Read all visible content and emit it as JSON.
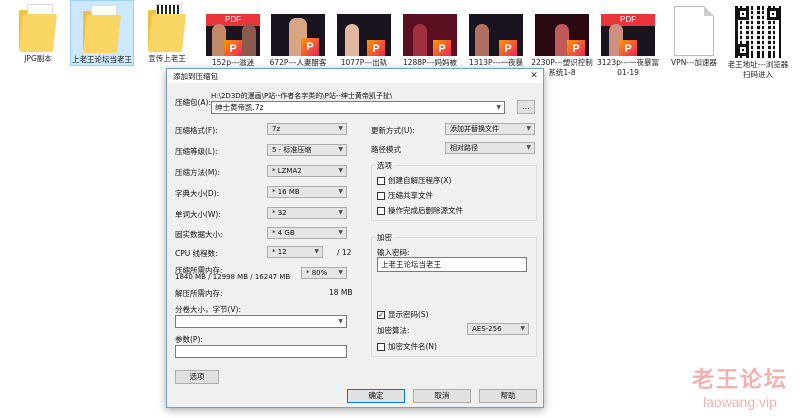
{
  "files": [
    {
      "label": "JPG副本",
      "kind": "folder"
    },
    {
      "label": "上老王论坛当老王",
      "kind": "folder",
      "selected": true
    },
    {
      "label": "宣传上老王",
      "kind": "folder"
    },
    {
      "label": "152p---滋迷",
      "kind": "pdf",
      "badge": "PDF"
    },
    {
      "label": "672P---人妻醋客",
      "kind": "pdf",
      "badge": ""
    },
    {
      "label": "1077P---出轨",
      "kind": "pdf",
      "badge": ""
    },
    {
      "label": "1288P---妈妈被",
      "kind": "pdf",
      "badge": ""
    },
    {
      "label": "1313P---一夜暴",
      "kind": "pdf",
      "badge": ""
    },
    {
      "label": "2230P---塑识控制系统1-8",
      "kind": "pdf",
      "badge": ""
    },
    {
      "label": "3123p---一夜暴富01-19",
      "kind": "pdf",
      "badge": "PDF"
    },
    {
      "label": "VPN---加速器",
      "kind": "doc"
    },
    {
      "label": "老王地址---浏览器扫码进入",
      "kind": "qr"
    }
  ],
  "dialog": {
    "title": "添加到压缩包",
    "close_glyph": "✕",
    "archive_label": "压缩包(A):",
    "archive_path": "H:\\2D3D的漫画\\P站--作者名字类的\\P站--绅士黄帝凯子扯\\",
    "archive_name": "绅士黄帝凯.7z",
    "browse_label": "...",
    "format_label": "压缩格式(F):",
    "format_value": "7z",
    "level_label": "压缩等级(L):",
    "level_value": "5 - 标准压缩",
    "method_label": "压缩方法(M):",
    "method_value": "* LZMA2",
    "dict_label": "字典大小(D):",
    "dict_value": "* 16 MB",
    "word_label": "单词大小(W):",
    "word_value": "* 32",
    "solid_label": "固实数据大小:",
    "solid_value": "* 4 GB",
    "cpu_label": "CPU 线程数:",
    "cpu_value": "* 12",
    "cpu_total": "/ 12",
    "mem_compress_label": "压缩所需内存:",
    "mem_compress_detail": "1840 MB / 12998 MB / 16247 MB",
    "mem_percent": "* 80%",
    "mem_decompress_label": "解压所需内存:",
    "mem_decompress_value": "18 MB",
    "split_label": "分卷大小，字节(V):",
    "split_value": "",
    "params_label": "参数(P):",
    "params_value": "",
    "options_button": "选项",
    "update_label": "更新方式(U):",
    "update_value": "添加并替换文件",
    "path_label": "路径模式",
    "path_value": "相对路径",
    "options_group": "选项",
    "opt_sfx": "创建自解压程序(X)",
    "opt_shared": "压缩共享文件",
    "opt_delete": "操作完成后删除源文件",
    "encrypt_group": "加密",
    "password_label": "输入密码:",
    "password_value": "上老王论坛当老王",
    "show_password": "显示密码(S)",
    "encrypt_method_label": "加密算法:",
    "encrypt_method_value": "AES-256",
    "encrypt_names": "加密文件名(N)",
    "ok": "确定",
    "cancel": "取消",
    "help": "帮助"
  },
  "watermark": {
    "title": "老王论坛",
    "url": "laowang.vip"
  }
}
